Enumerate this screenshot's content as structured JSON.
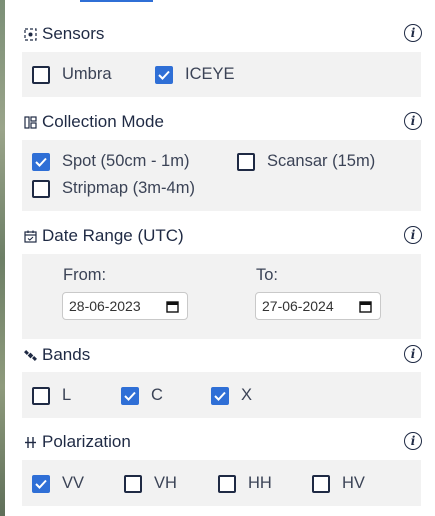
{
  "colors": {
    "accent": "#2f6fd6",
    "text": "#1f2a44",
    "panel": "#f2f2f2"
  },
  "sections": {
    "sensors": {
      "title": "Sensors",
      "icon": "sensor-icon",
      "options": [
        {
          "label": "Umbra",
          "checked": false
        },
        {
          "label": "ICEYE",
          "checked": true
        }
      ]
    },
    "collection_mode": {
      "title": "Collection Mode",
      "icon": "grid-icon",
      "options": [
        {
          "label": "Spot (50cm - 1m)",
          "checked": true
        },
        {
          "label": "Scansar (15m)",
          "checked": false
        },
        {
          "label": "Stripmap (3m-4m)",
          "checked": false
        }
      ]
    },
    "date_range": {
      "title": "Date Range (UTC)",
      "icon": "calendar-icon",
      "from_label": "From:",
      "from_value": "28-06-2023",
      "to_label": "To:",
      "to_value": "27-06-2024"
    },
    "bands": {
      "title": "Bands",
      "icon": "satellite-icon",
      "options": [
        {
          "label": "L",
          "checked": false
        },
        {
          "label": "C",
          "checked": true
        },
        {
          "label": "X",
          "checked": true
        }
      ]
    },
    "polarization": {
      "title": "Polarization",
      "icon": "polarization-icon",
      "options": [
        {
          "label": "VV",
          "checked": true
        },
        {
          "label": "VH",
          "checked": false
        },
        {
          "label": "HH",
          "checked": false
        },
        {
          "label": "HV",
          "checked": false
        }
      ]
    }
  },
  "info_glyph": "i"
}
